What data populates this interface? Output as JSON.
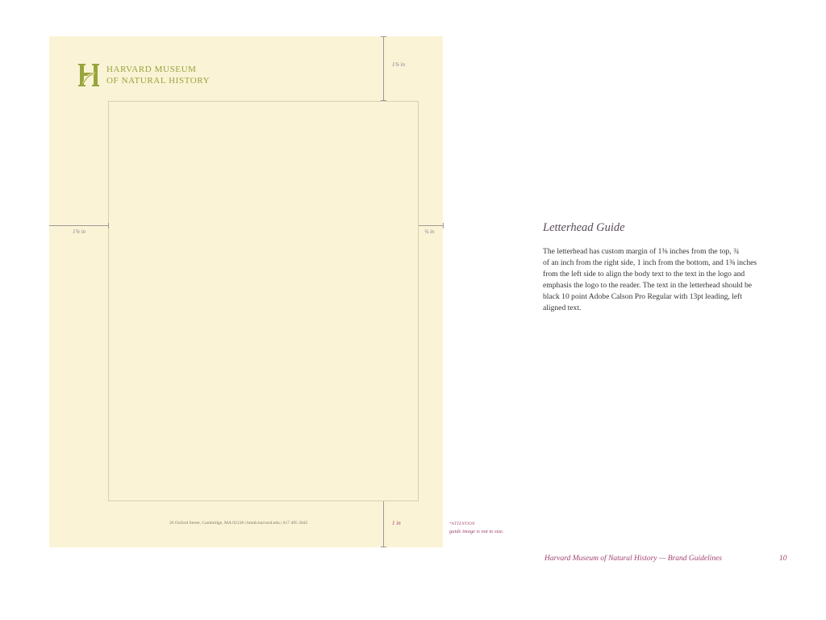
{
  "letterhead": {
    "logo_line1": "HARVARD MUSEUM",
    "logo_line2": "OF NATURAL HISTORY",
    "address": "26 Oxford Street, Cambridge, MA 02138 | hmnh.harvard.edu | 617 495 3045"
  },
  "measurements": {
    "top": "1⅜ in",
    "left": "1⅜ in",
    "right": "¾ in",
    "bottom": "1 in"
  },
  "attention": {
    "label": "*ATTENTION",
    "note": "guide image is not to size."
  },
  "content": {
    "title": "Letterhead Guide",
    "paragraph_lines": [
      "The letterhead has custom margin of 1⅜ inches from the top, ¾",
      "of an inch from the right side, 1 inch from the bottom, and 1⅜ inches",
      "from the left side to align the body text to the text in the logo and",
      "emphasis the logo to the reader. The text in the letterhead should be",
      "black 10 point Adobe Calson Pro Regular with 13pt leading, left",
      "aligned text."
    ]
  },
  "footer": {
    "text": "Harvard Museum of Natural History — Brand Guidelines",
    "page_number": "10"
  },
  "colors": {
    "paper": "#fbf3d6",
    "logo_green": "#97a53c",
    "accent_magenta": "#a0436e"
  }
}
